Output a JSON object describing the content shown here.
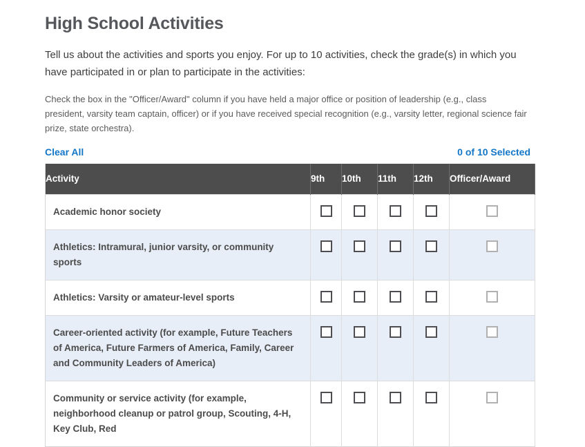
{
  "page": {
    "title": "High School Activities",
    "intro": "Tell us about the activities and sports you enjoy. For up to 10 activities, check the grade(s) in which you have participated in or plan to participate in the activities:",
    "note": "Check the box in the \"Officer/Award\" column if you have held a major office or position of leadership (e.g., class president, varsity team captain, officer) or if you have received special recognition (e.g., varsity letter, regional science fair prize, state orchestra)."
  },
  "actions": {
    "clear_all_label": "Clear All",
    "selected_count_label": "0 of 10 Selected",
    "link_color": "#1276c8"
  },
  "table": {
    "header_bg": "#4d4d4d",
    "alt_row_bg": "#e8eef8",
    "columns": {
      "activity": "Activity",
      "grade9": "9th",
      "grade10": "10th",
      "grade11": "11th",
      "grade12": "12th",
      "award": "Officer/Award"
    },
    "rows": [
      {
        "activity": "Academic honor society",
        "grade9": false,
        "grade10": false,
        "grade11": false,
        "grade12": false,
        "award": false,
        "award_disabled": true
      },
      {
        "activity": "Athletics: Intramural, junior varsity, or community sports",
        "grade9": false,
        "grade10": false,
        "grade11": false,
        "grade12": false,
        "award": false,
        "award_disabled": true
      },
      {
        "activity": "Athletics: Varsity or amateur-level sports",
        "grade9": false,
        "grade10": false,
        "grade11": false,
        "grade12": false,
        "award": false,
        "award_disabled": true
      },
      {
        "activity": "Career-oriented activity (for example, Future Teachers of America, Future Farmers of America, Family, Career and Community Leaders of America)",
        "grade9": false,
        "grade10": false,
        "grade11": false,
        "grade12": false,
        "award": false,
        "award_disabled": true
      },
      {
        "activity": "Community or service activity (for example, neighborhood cleanup or patrol group, Scouting, 4-H, Key Club, Red",
        "grade9": false,
        "grade10": false,
        "grade11": false,
        "grade12": false,
        "award": false,
        "award_disabled": true
      }
    ]
  }
}
